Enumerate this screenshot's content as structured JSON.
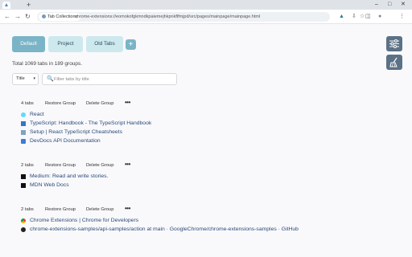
{
  "browser": {
    "new_tab_glyph": "+",
    "window_controls": [
      "–",
      "□",
      "✕"
    ],
    "nav": {
      "back": "←",
      "forward": "→",
      "reload": "↻"
    },
    "tab_group_chip": "Tab Collections",
    "url": "chrome-extensions://eomokofgkmndkpaiemejhkpnkflfmjpd/src/pages/mainpage/mainpage.html",
    "bookmark_star": "☆",
    "toolbar_icons": [
      "▲",
      "⇩",
      "◫",
      "●",
      "⋮"
    ]
  },
  "groups_bar": {
    "buttons": [
      "Default",
      "Project",
      "Old Tabs"
    ],
    "active": "Default",
    "add_label": "+"
  },
  "side_buttons": [
    "settings-sliders-icon",
    "broom-icon"
  ],
  "summary": {
    "total_text": "Total 1069 tabs in 189 groups."
  },
  "sort": {
    "selected": "Title",
    "caret": "▾"
  },
  "filter": {
    "placeholder": "Filter tabs by title",
    "value": "",
    "icon": "🔍"
  },
  "action_labels": {
    "restore": "Restore Group",
    "delete": "Delete Group",
    "more": "•••"
  },
  "groups": [
    {
      "count": "4 tabs",
      "tabs": [
        {
          "title": "React",
          "icon": "react-icon",
          "color": "#61dafb"
        },
        {
          "title": "TypeScript: Handbook - The TypeScript Handbook",
          "icon": "typescript-icon",
          "color": "#3178c6"
        },
        {
          "title": "Setup | React TypeScript Cheatsheets",
          "icon": "cheatsheet-icon",
          "color": "#7aa6c2"
        },
        {
          "title": "DevDocs API Documentation",
          "icon": "devdocs-icon",
          "color": "#3b7dd8"
        }
      ]
    },
    {
      "count": "2 tabs",
      "tabs": [
        {
          "title": "Medium: Read and write stories.",
          "icon": "medium-icon",
          "color": "#111111"
        },
        {
          "title": "MDN Web Docs",
          "icon": "mdn-icon",
          "color": "#111111"
        }
      ]
    },
    {
      "count": "2 tabs",
      "tabs": [
        {
          "title": "Chrome Extensions  |  Chrome for Developers",
          "icon": "chrome-icon",
          "color": "#db4437"
        },
        {
          "title": "chrome-extensions-samples/api-samples/action at main · GoogleChrome/chrome-extensions-samples · GitHub",
          "icon": "github-icon",
          "color": "#222222"
        }
      ]
    }
  ]
}
